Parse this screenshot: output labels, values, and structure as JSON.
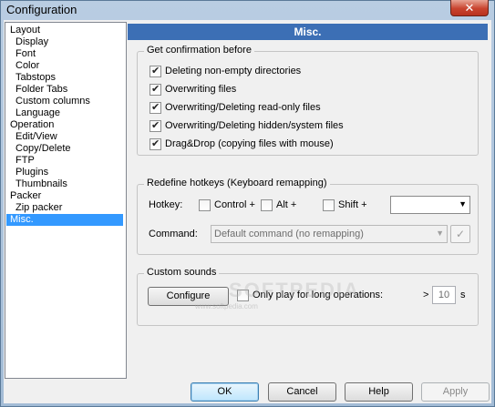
{
  "window": {
    "title": "Configuration",
    "close_label": "✕"
  },
  "tree": {
    "items": [
      {
        "label": "Layout",
        "level": 0
      },
      {
        "label": "Display",
        "level": 1
      },
      {
        "label": "Font",
        "level": 1
      },
      {
        "label": "Color",
        "level": 1
      },
      {
        "label": "Tabstops",
        "level": 1
      },
      {
        "label": "Folder Tabs",
        "level": 1
      },
      {
        "label": "Custom columns",
        "level": 1
      },
      {
        "label": "Language",
        "level": 1
      },
      {
        "label": "Operation",
        "level": 0
      },
      {
        "label": "Edit/View",
        "level": 1
      },
      {
        "label": "Copy/Delete",
        "level": 1
      },
      {
        "label": "FTP",
        "level": 1
      },
      {
        "label": "Plugins",
        "level": 1
      },
      {
        "label": "Thumbnails",
        "level": 1
      },
      {
        "label": "Packer",
        "level": 0
      },
      {
        "label": "Zip packer",
        "level": 1
      },
      {
        "label": "Misc.",
        "level": 0,
        "selected": true
      }
    ]
  },
  "panel": {
    "title": "Misc."
  },
  "confirm_group": {
    "legend": "Get confirmation before",
    "items": [
      {
        "label": "Deleting non-empty directories",
        "checked": true
      },
      {
        "label": "Overwriting files",
        "checked": true
      },
      {
        "label": "Overwriting/Deleting read-only files",
        "checked": true
      },
      {
        "label": "Overwriting/Deleting hidden/system files",
        "checked": true
      },
      {
        "label": "Drag&Drop (copying files with mouse)",
        "checked": true
      }
    ]
  },
  "hotkeys_group": {
    "legend": "Redefine hotkeys (Keyboard remapping)",
    "hotkey_label": "Hotkey:",
    "control_label": "Control +",
    "alt_label": "Alt +",
    "shift_label": "Shift +",
    "key_value": "",
    "command_label": "Command:",
    "command_value": "Default command (no remapping)",
    "apply_icon": "check-icon"
  },
  "sounds_group": {
    "legend": "Custom sounds",
    "configure_label": "Configure",
    "long_ops_label": "Only play for long operations:",
    "gt_label": ">",
    "seconds_value": "10",
    "seconds_unit": "s"
  },
  "watermark": {
    "text": "SOFTPEDIA",
    "sub": "www.softpedia.com"
  },
  "buttons": {
    "ok": "OK",
    "cancel": "Cancel",
    "help": "Help",
    "apply": "Apply"
  }
}
